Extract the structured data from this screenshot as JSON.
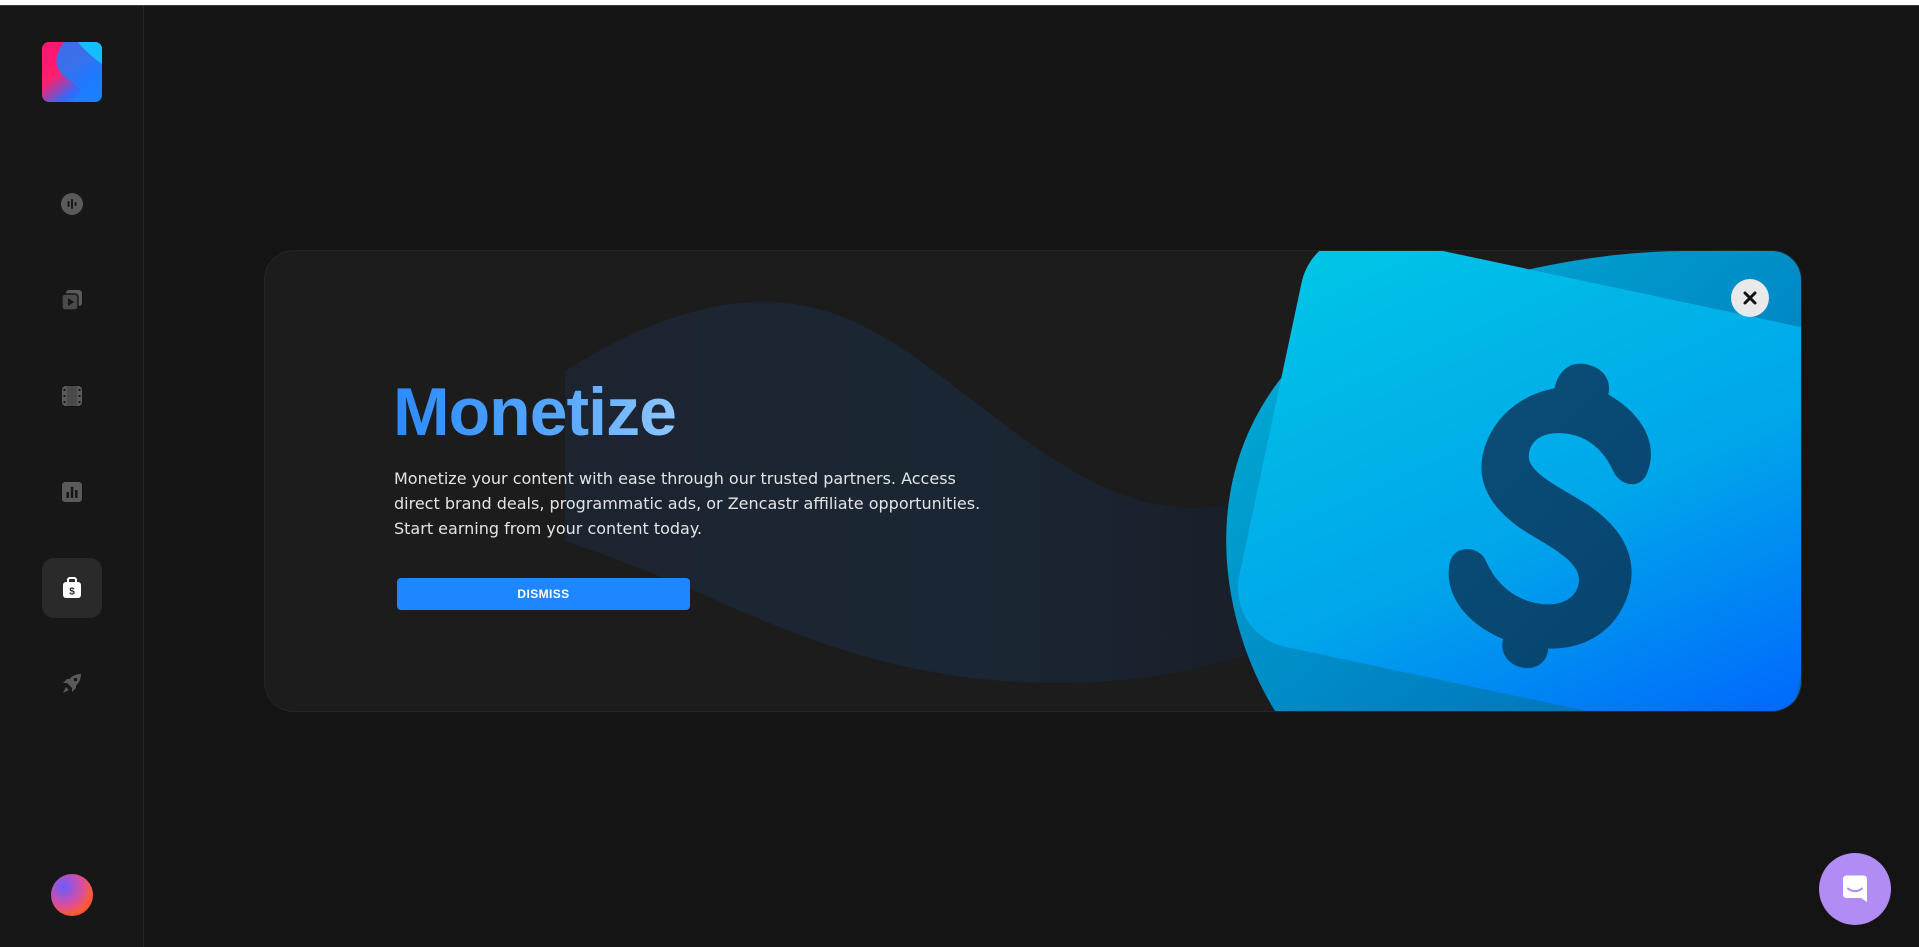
{
  "app": {
    "name": "Zencastr"
  },
  "sidebar": {
    "logo_icon": "zencastr-logo-icon",
    "items": [
      {
        "id": "podcasts",
        "icon": "podcast-icon",
        "active": false
      },
      {
        "id": "episodes",
        "icon": "episodes-icon",
        "active": false
      },
      {
        "id": "video",
        "icon": "film-icon",
        "active": false
      },
      {
        "id": "analytics",
        "icon": "bar-chart-icon",
        "active": false
      },
      {
        "id": "monetize",
        "icon": "money-bag-icon",
        "active": true
      },
      {
        "id": "launch",
        "icon": "rocket-icon",
        "active": false
      }
    ],
    "avatar_icon": "user-avatar"
  },
  "promo": {
    "title": "Monetize",
    "description": "Monetize your content with ease through our trusted partners. Access direct brand deals, programmatic ads, or Zencastr affiliate opportunities. Start earning from your content today.",
    "dismiss_label": "DISMISS",
    "close_icon": "close-icon",
    "illustration_icon": "dollar-card-icon"
  },
  "chat": {
    "icon": "chat-bubble-icon"
  },
  "colors": {
    "background": "#141414",
    "sidebar": "#171717",
    "accent": "#1e86ff",
    "title_gradient_start": "#2d8bff",
    "chat_launcher": "#b08cf4"
  }
}
